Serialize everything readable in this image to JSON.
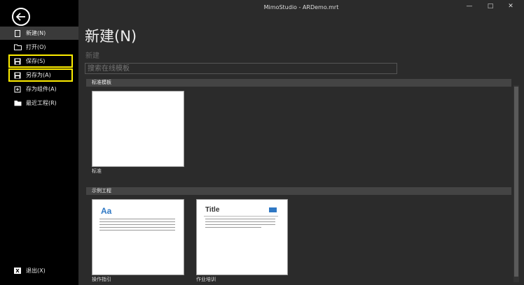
{
  "window": {
    "title": "MimoStudio - ARDemo.mrt",
    "minimize": "—",
    "maximize": "□",
    "close": "✕"
  },
  "sidebar": {
    "items": [
      {
        "label": "新建(N)",
        "icon": "new-file-icon"
      },
      {
        "label": "打开(O)",
        "icon": "folder-open-icon"
      },
      {
        "label": "保存(S)",
        "icon": "save-icon"
      },
      {
        "label": "另存为(A)",
        "icon": "save-as-icon"
      },
      {
        "label": "存为组件(A)",
        "icon": "save-component-icon"
      },
      {
        "label": "最近工程(R)",
        "icon": "folder-icon"
      }
    ],
    "exit_label": "退出(X)"
  },
  "main": {
    "title": "新建(N)",
    "subtitle": "新建",
    "search_placeholder": "搜索在线模板",
    "sections": [
      {
        "header": "标准模板",
        "templates": [
          {
            "label": "标准"
          }
        ]
      },
      {
        "header": "示例工程",
        "templates": [
          {
            "label": "操作指引",
            "heading": "Aa"
          },
          {
            "label": "作业培训",
            "heading": "Title"
          }
        ]
      }
    ]
  },
  "colors": {
    "highlight": "#ffee00",
    "accent_blue": "#2f78c4"
  }
}
